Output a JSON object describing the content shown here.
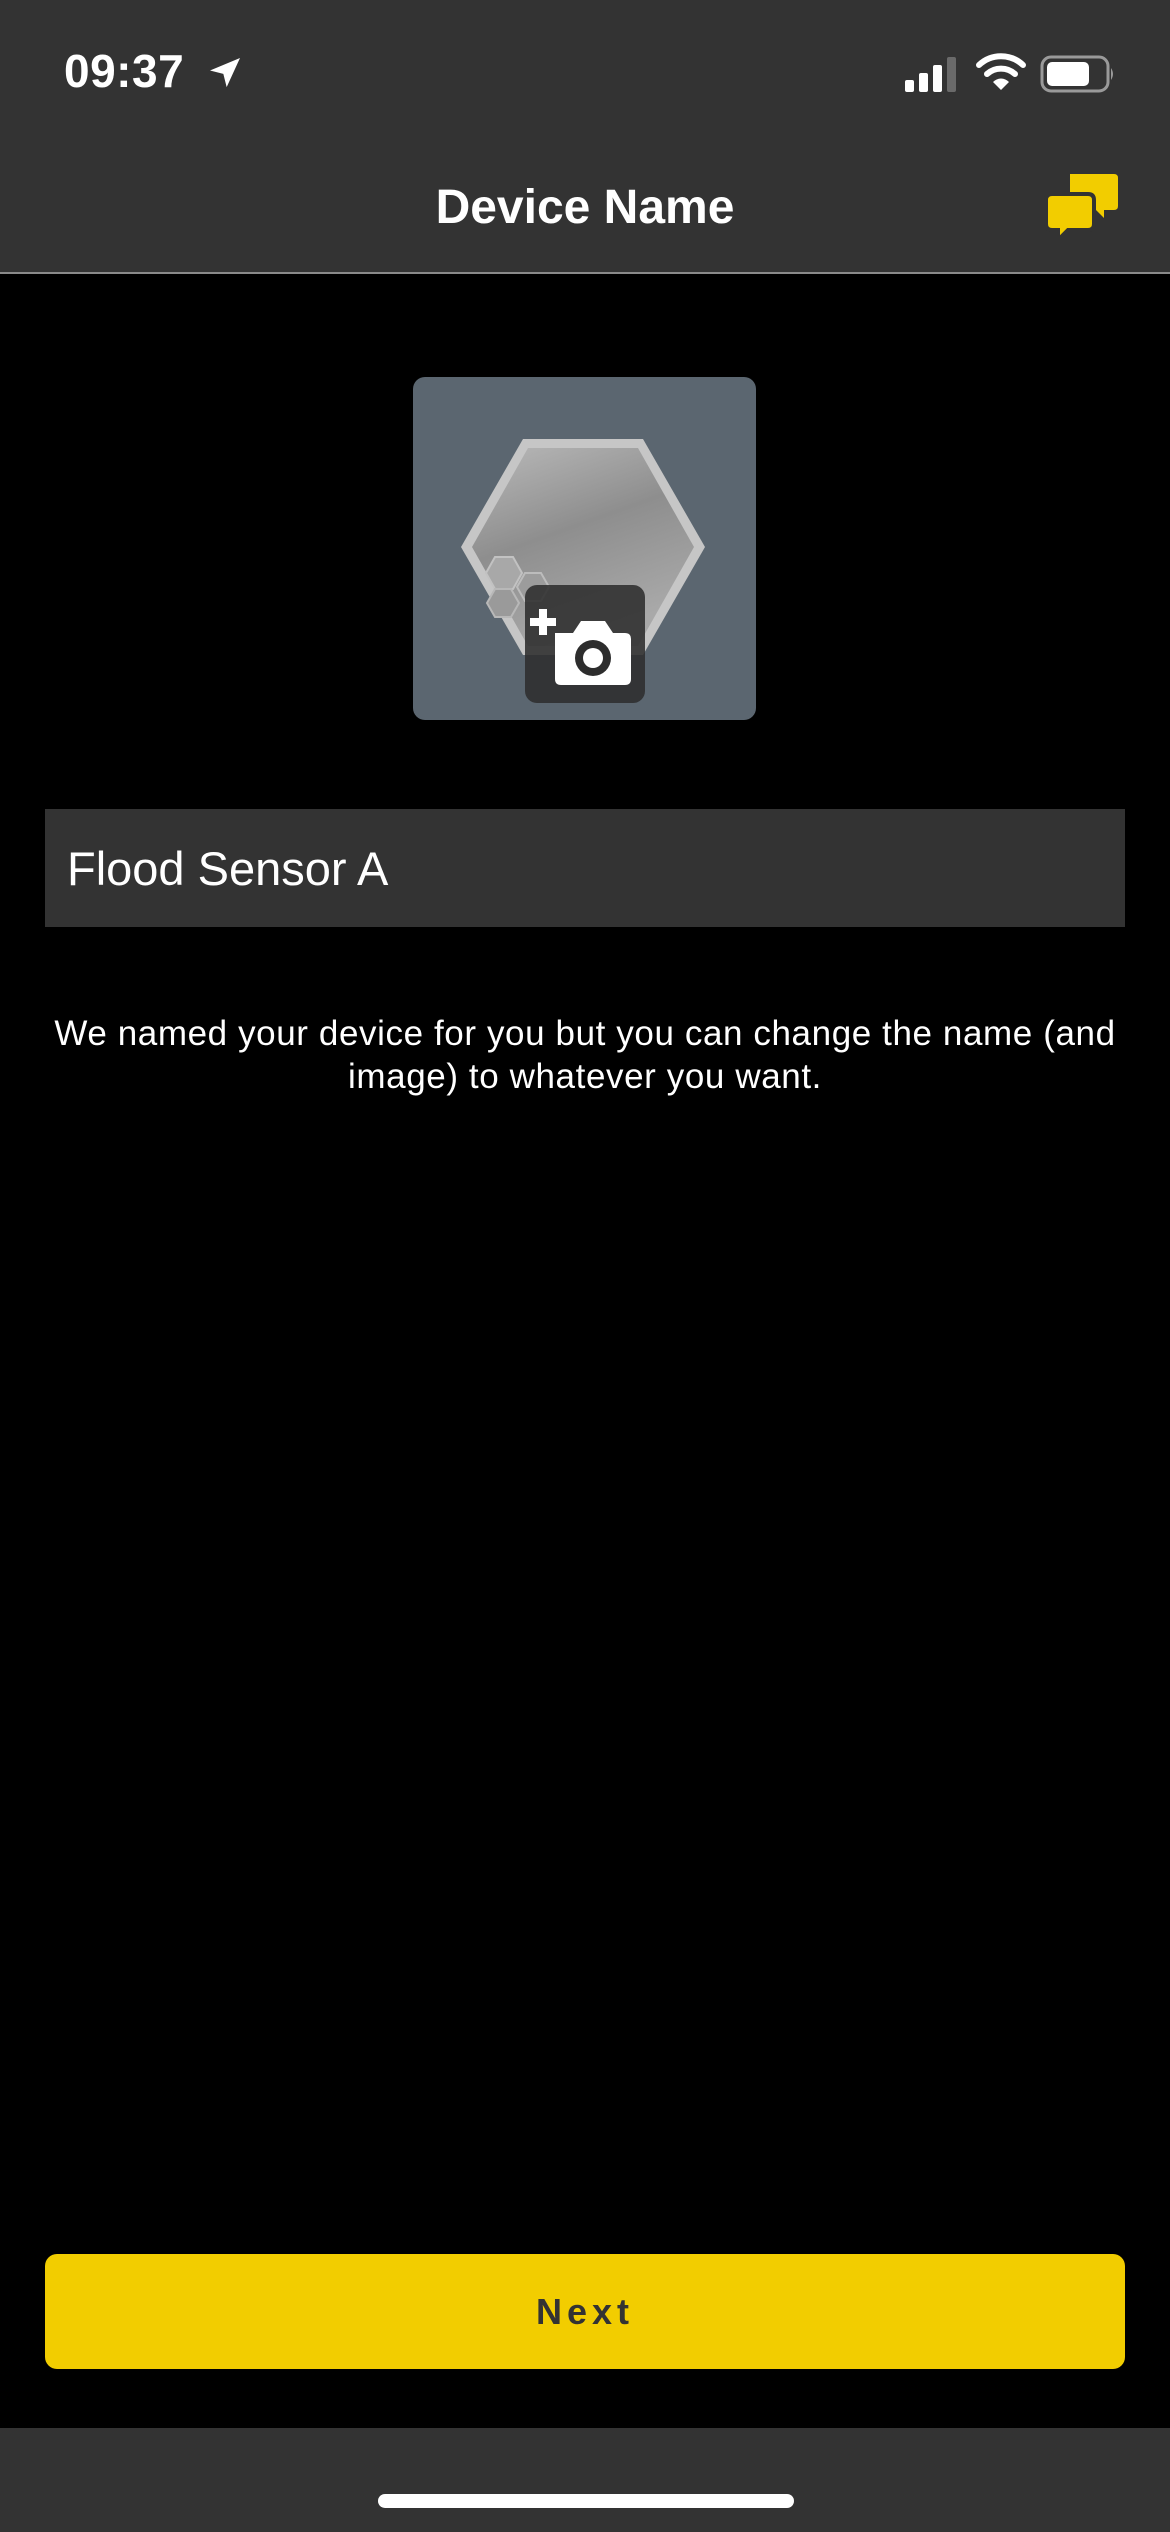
{
  "status_bar": {
    "time": "09:37",
    "icons": [
      "location-arrow-icon",
      "cellular-signal-icon",
      "wifi-icon",
      "battery-icon"
    ]
  },
  "nav": {
    "title": "Device Name",
    "right_icon": "chat-bubbles-icon"
  },
  "device_image": {
    "overlay_icon": "add-photo-camera-icon"
  },
  "name_field": {
    "value": "Flood Sensor A"
  },
  "help_text": "We named your device for you but you can change the name (and image) to whatever you want.",
  "next_button": {
    "label": "Next"
  },
  "colors": {
    "accent": "#f2cd00",
    "bar_background": "#333333",
    "page_background": "#000000",
    "image_tile": "#5b6670"
  }
}
